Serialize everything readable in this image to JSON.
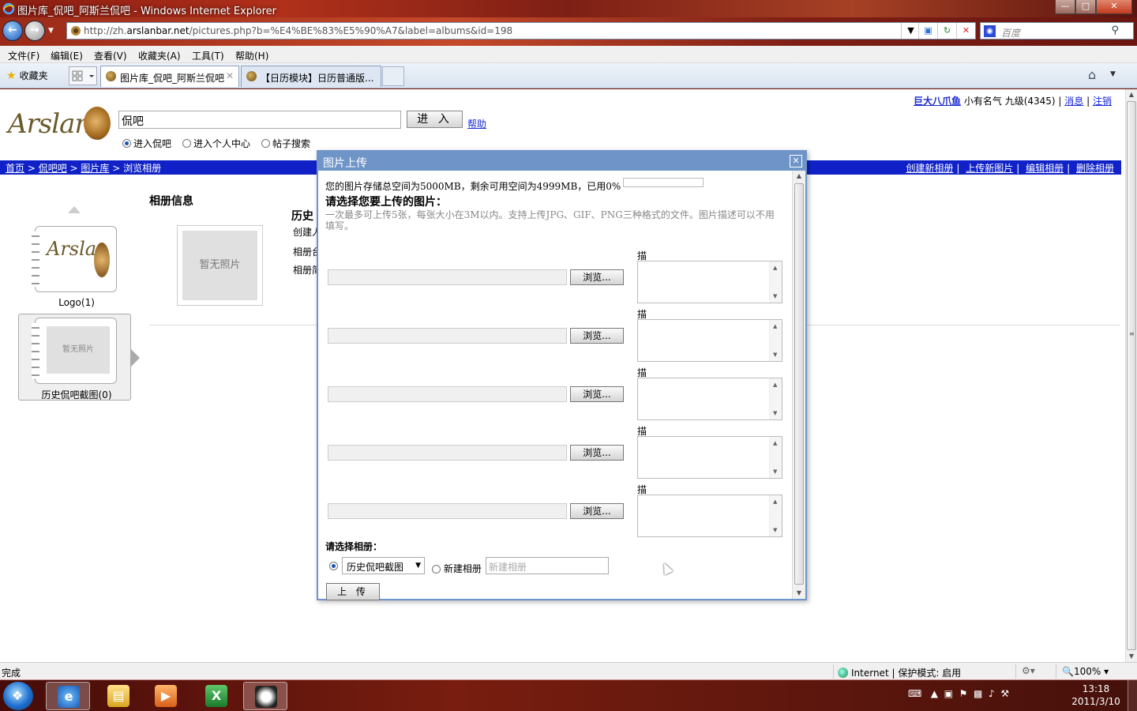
{
  "window": {
    "title": "图片库_侃吧_阿斯兰侃吧 - Windows Internet Explorer",
    "url_prefix": "http://zh.",
    "url_domain": "arslanbar.net",
    "url_rest": "/pictures.php?b=%E4%BE%83%E5%90%A7&label=albums&id=198",
    "search_placeholder": "百度"
  },
  "menu": [
    "文件(F)",
    "编辑(E)",
    "查看(V)",
    "收藏夹(A)",
    "工具(T)",
    "帮助(H)"
  ],
  "tabs": {
    "favorites": "收藏夹",
    "active": "图片库_侃吧_阿斯兰侃吧",
    "inactive": "【日历模块】日历普通版..."
  },
  "site": {
    "user": "巨大八爪鱼",
    "rank": "小有名气",
    "level": "九级(4345)",
    "messages": "消息",
    "logout": "注销",
    "logo_text": "Arslan",
    "search_value": "侃吧",
    "enter_button": "进 入",
    "help": "帮助",
    "radio_options": [
      "进入侃吧",
      "进入个人中心",
      "帖子搜索"
    ],
    "breadcrumb": [
      "首页",
      "侃吧吧",
      "图片库",
      "浏览相册"
    ],
    "actions": [
      "创建新相册",
      "上传新图片",
      "编辑相册",
      "删除相册"
    ],
    "album1_caption": "Logo(1)",
    "album2_caption": "历史侃吧截图(0)",
    "album2_placeholder": "暂无照片",
    "info_header": "相册信息",
    "no_photo": "暂无照片",
    "history_header": "历史",
    "info_lines": [
      "创建人",
      "相册台",
      "相册简"
    ]
  },
  "dialog": {
    "title": "图片上传",
    "quota": "您的图片存储总空间为5000MB，剩余可用空间为4999MB，已用0%",
    "choose": "请选择您要上传的图片：",
    "note": "一次最多可上传5张，每张大小在3M以内。支持上传JPG、GIF、PNG三种格式的文件。图片描述可以不用填写。",
    "browse_label": "浏览...",
    "desc_label": "描述:",
    "pick_album": "请选择相册：",
    "album_select": "历史侃吧截图",
    "new_album_label": "新建相册",
    "new_album_placeholder": "新建相册",
    "upload_button": "上 传"
  },
  "status": {
    "text": "完成",
    "zone": "Internet | 保护模式: 启用",
    "zoom": "100%"
  },
  "taskbar": {
    "time": "13:18",
    "date": "2011/3/10"
  }
}
